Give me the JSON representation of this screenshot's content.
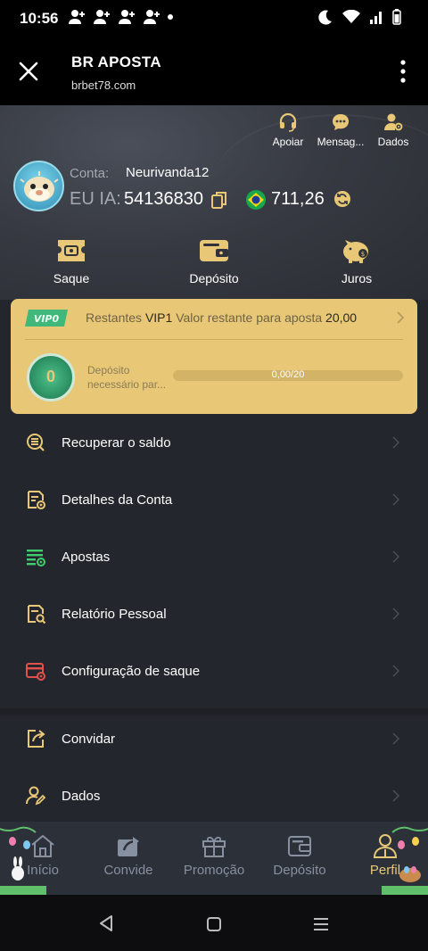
{
  "status_bar": {
    "time": "10:56"
  },
  "browser": {
    "title": "BR APOSTA",
    "url": "brbet78.com"
  },
  "top_actions": [
    {
      "label": "Apoiar",
      "icon": "headset-icon"
    },
    {
      "label": "Mensag...",
      "icon": "chat-icon"
    },
    {
      "label": "Dados",
      "icon": "user-gear-icon"
    }
  ],
  "account": {
    "label": "Conta:",
    "name": "Neurivanda12",
    "id_label": "EU IA:",
    "id_value": "54136830",
    "balance": "711,26"
  },
  "quick_actions": [
    {
      "label": "Saque",
      "icon": "ticket-icon"
    },
    {
      "label": "Depósito",
      "icon": "wallet-icon"
    },
    {
      "label": "Juros",
      "icon": "piggy-bank-icon"
    }
  ],
  "vip": {
    "badge": "VIP0",
    "remaining_label": "Restantes",
    "level": "VIP1",
    "remaining_text": "Valor restante para aposta",
    "remaining_value": "20,00",
    "medal_value": "0",
    "deposit_text": "Depósito necessário par...",
    "progress_text": "0,00/20",
    "progress_fraction": 0
  },
  "menu": [
    {
      "label": "Recuperar o saldo",
      "icon": "coins-refresh-icon",
      "color": "#e8c877"
    },
    {
      "label": "Detalhes da Conta",
      "icon": "account-details-icon",
      "color": "#e8c877"
    },
    {
      "label": "Apostas",
      "icon": "bets-list-icon",
      "color": "#3fce6b"
    },
    {
      "label": "Relatório Pessoal",
      "icon": "report-search-icon",
      "color": "#e8c877"
    },
    {
      "label": "Configuração de saque",
      "icon": "withdraw-settings-icon",
      "color": "#e0504d"
    }
  ],
  "menu2": [
    {
      "label": "Convidar",
      "icon": "share-icon"
    },
    {
      "label": "Dados",
      "icon": "user-edit-icon"
    }
  ],
  "bottom_nav": [
    {
      "label": "Início",
      "icon": "home-icon"
    },
    {
      "label": "Convide",
      "icon": "share-arrow-icon"
    },
    {
      "label": "Promoção",
      "icon": "gift-icon"
    },
    {
      "label": "Depósito",
      "icon": "wallet-icon"
    },
    {
      "label": "Perfil",
      "icon": "profile-icon",
      "active": true
    }
  ],
  "colors": {
    "accent": "#e8c877",
    "background": "#23262c",
    "nav_inactive": "#8790a0"
  }
}
